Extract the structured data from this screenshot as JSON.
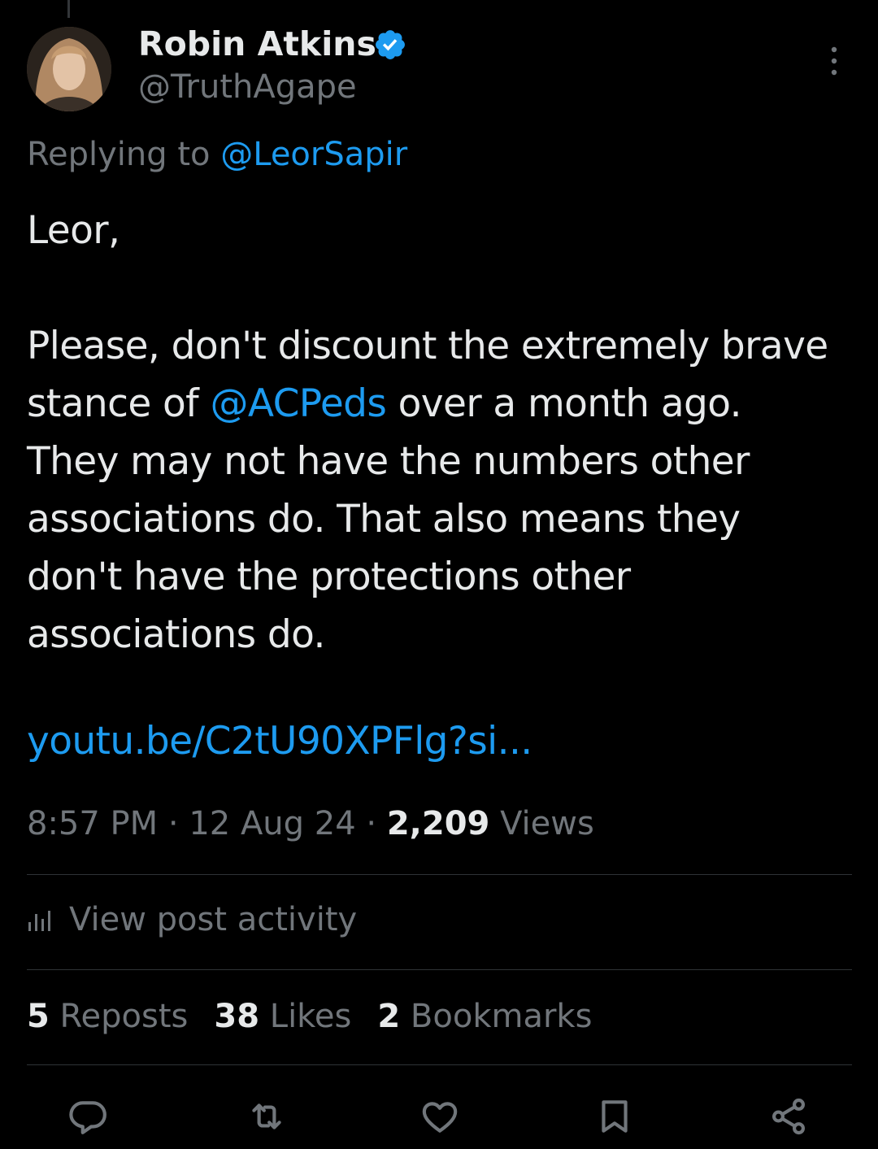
{
  "author": {
    "display_name": "Robin Atkins",
    "handle": "@TruthAgape"
  },
  "reply": {
    "prefix": "Replying to ",
    "mention": "@LeorSapir"
  },
  "body": {
    "greeting": "Leor,",
    "para_before_mention": "Please, don't discount the extremely brave stance of ",
    "mention": "@ACPeds",
    "para_after_mention": " over a month ago. They may not have the numbers other associations do. That also means they don't have the protections other associations do.",
    "link": "youtu.be/C2tU90XPFlg?si..."
  },
  "meta": {
    "time": "8:57 PM",
    "sep1": " · ",
    "date": "12 Aug 24",
    "sep2": " · ",
    "views_count": "2,209",
    "views_label": " Views"
  },
  "activity": {
    "label": "View post activity",
    "icon": "analytics-icon"
  },
  "stats": {
    "reposts_count": "5",
    "reposts_label": " Reposts",
    "likes_count": "38",
    "likes_label": " Likes",
    "bookmarks_count": "2",
    "bookmarks_label": " Bookmarks"
  },
  "icons": {
    "verified": "verified-badge-icon",
    "more": "more-options-icon",
    "reply": "reply-icon",
    "repost": "repost-icon",
    "like": "like-icon",
    "bookmark": "bookmark-icon",
    "share": "share-icon"
  },
  "colors": {
    "background": "#000000",
    "text": "#e7e9ea",
    "muted": "#71767b",
    "accent": "#1d9bf0",
    "divider": "#2f3336"
  }
}
